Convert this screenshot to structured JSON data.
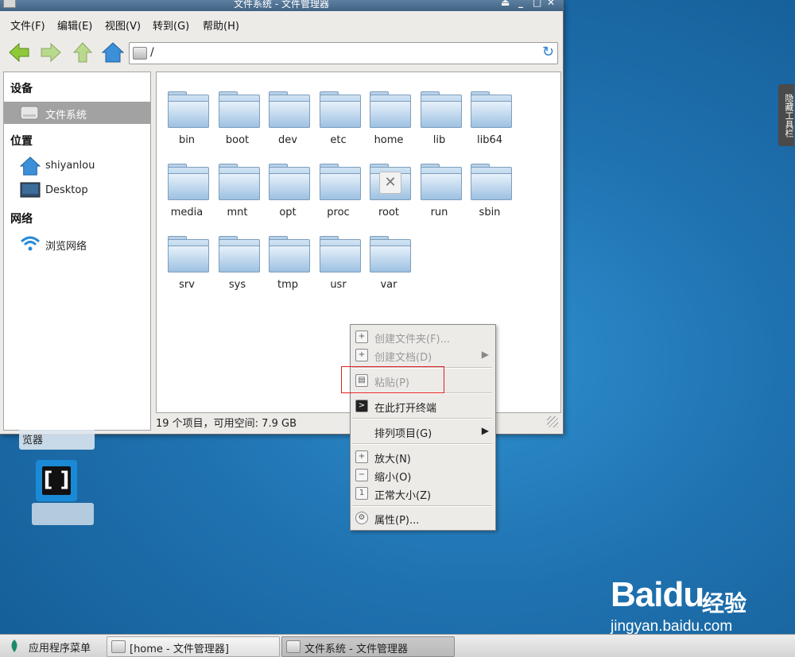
{
  "window": {
    "title": "文件系统 - 文件管理器",
    "controls": [
      "⏏",
      "_",
      "□",
      "✕"
    ]
  },
  "menubar": [
    "文件(F)",
    "编辑(E)",
    "视图(V)",
    "转到(G)",
    "帮助(H)"
  ],
  "location": {
    "path": "/"
  },
  "sidebar": {
    "devices_header": "设备",
    "devices": [
      {
        "label": "文件系统",
        "icon": "drive-icon",
        "selected": true
      }
    ],
    "places_header": "位置",
    "places": [
      {
        "label": "shiyanlou",
        "icon": "home-icon"
      },
      {
        "label": "Desktop",
        "icon": "desktop-icon"
      }
    ],
    "network_header": "网络",
    "network": [
      {
        "label": "浏览网络",
        "icon": "wifi-icon"
      }
    ]
  },
  "folders": [
    "bin",
    "boot",
    "dev",
    "etc",
    "home",
    "lib",
    "lib64",
    "media",
    "mnt",
    "opt",
    "proc",
    "root",
    "run",
    "sbin",
    "srv",
    "sys",
    "tmp",
    "usr",
    "var"
  ],
  "status": {
    "text": "19 个项目，可用空间: 7.9 GB"
  },
  "context_menu": {
    "items": [
      {
        "label": "创建文件夹(F)...",
        "disabled": true,
        "icon": "new-folder-icon"
      },
      {
        "label": "创建文档(D)",
        "disabled": true,
        "icon": "new-document-icon",
        "submenu": true
      },
      {
        "label": "粘贴(P)",
        "disabled": true,
        "icon": "paste-icon"
      },
      {
        "label": "在此打开终端",
        "disabled": false,
        "icon": "terminal-icon"
      },
      {
        "label": "排列项目(G)",
        "disabled": false,
        "submenu": true
      },
      {
        "label": "放大(N)",
        "disabled": false,
        "icon": "zoom-in-icon"
      },
      {
        "label": "缩小(O)",
        "disabled": false,
        "icon": "zoom-out-icon"
      },
      {
        "label": "正常大小(Z)",
        "disabled": false,
        "icon": "zoom-normal-icon"
      },
      {
        "label": "属性(P)...",
        "disabled": false,
        "icon": "gear-icon"
      }
    ],
    "highlight_color": "#e02020"
  },
  "side_tab": {
    "label": "隐藏工具栏"
  },
  "desktop": {
    "browser_label": "览器"
  },
  "watermark": {
    "brand": "Baidu",
    "brand_cn": "经验",
    "url": "jingyan.baidu.com"
  },
  "taskbar": {
    "menu_label": "应用程序菜单",
    "tasks": [
      {
        "label": "[home - 文件管理器]",
        "active": false
      },
      {
        "label": "文件系统 - 文件管理器",
        "active": true
      }
    ]
  },
  "colors": {
    "folder": "#9dc1e2",
    "desktop": "#1f72b0",
    "title_bar": "#4f7091"
  }
}
